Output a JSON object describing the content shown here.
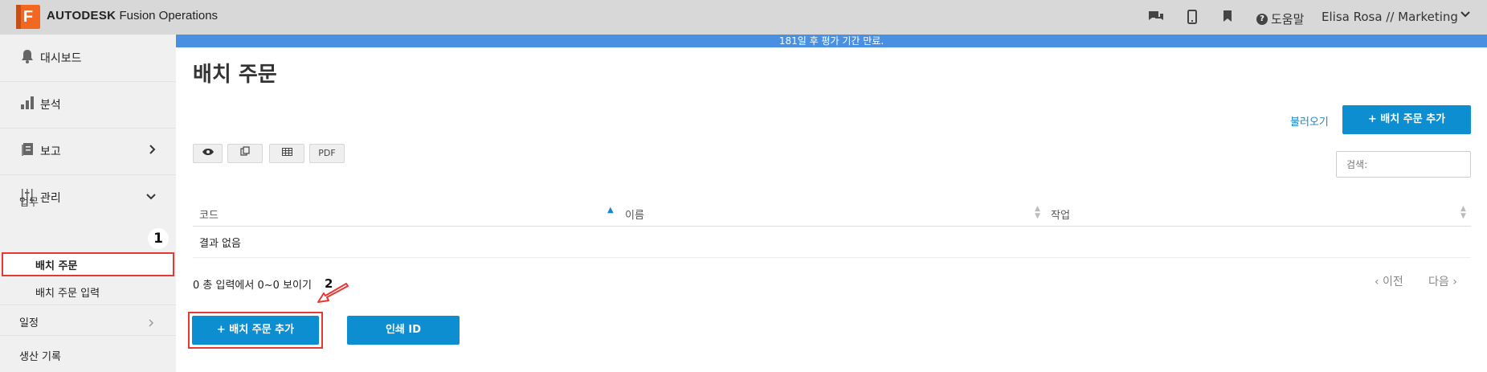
{
  "app": {
    "logo_letter": "F",
    "brand_bold": "AUTODESK",
    "brand_rest": "Fusion Operations",
    "help_label": "도움말",
    "user_label": "Elisa Rosa // Marketing"
  },
  "banner": {
    "text": "181일 후 평가 기간 만료."
  },
  "sidebar": {
    "dashboard": "대시보드",
    "analysis": "분석",
    "reports": "보고",
    "manage": "관리",
    "section_work": "업무",
    "batch_orders": "배치 주문",
    "batch_order_entry": "배치 주문 입력",
    "schedule": "일정",
    "production_records": "생산 기록"
  },
  "annotations": {
    "badge_1": "1",
    "badge_2": "2"
  },
  "main": {
    "title": "배치 주문",
    "load_link": "불러오기",
    "add_button_top": "+ 배치 주문 추가",
    "tool_pdf": "PDF",
    "search_placeholder": "검색:",
    "table": {
      "columns": [
        "코드",
        "이름",
        "작업"
      ],
      "empty_text": "결과 없음"
    },
    "info_text": "0 총 입력에서 0~0 보이기",
    "prev": "‹ 이전",
    "next": "다음 ›",
    "add_button_bottom": "+ 배치 주문 추가",
    "print_id_button": "인쇄 ID"
  },
  "colors": {
    "accent": "#0c8ed1",
    "banner": "#4a90e2",
    "annotation_red": "#e53935",
    "logo": "#f26722"
  }
}
